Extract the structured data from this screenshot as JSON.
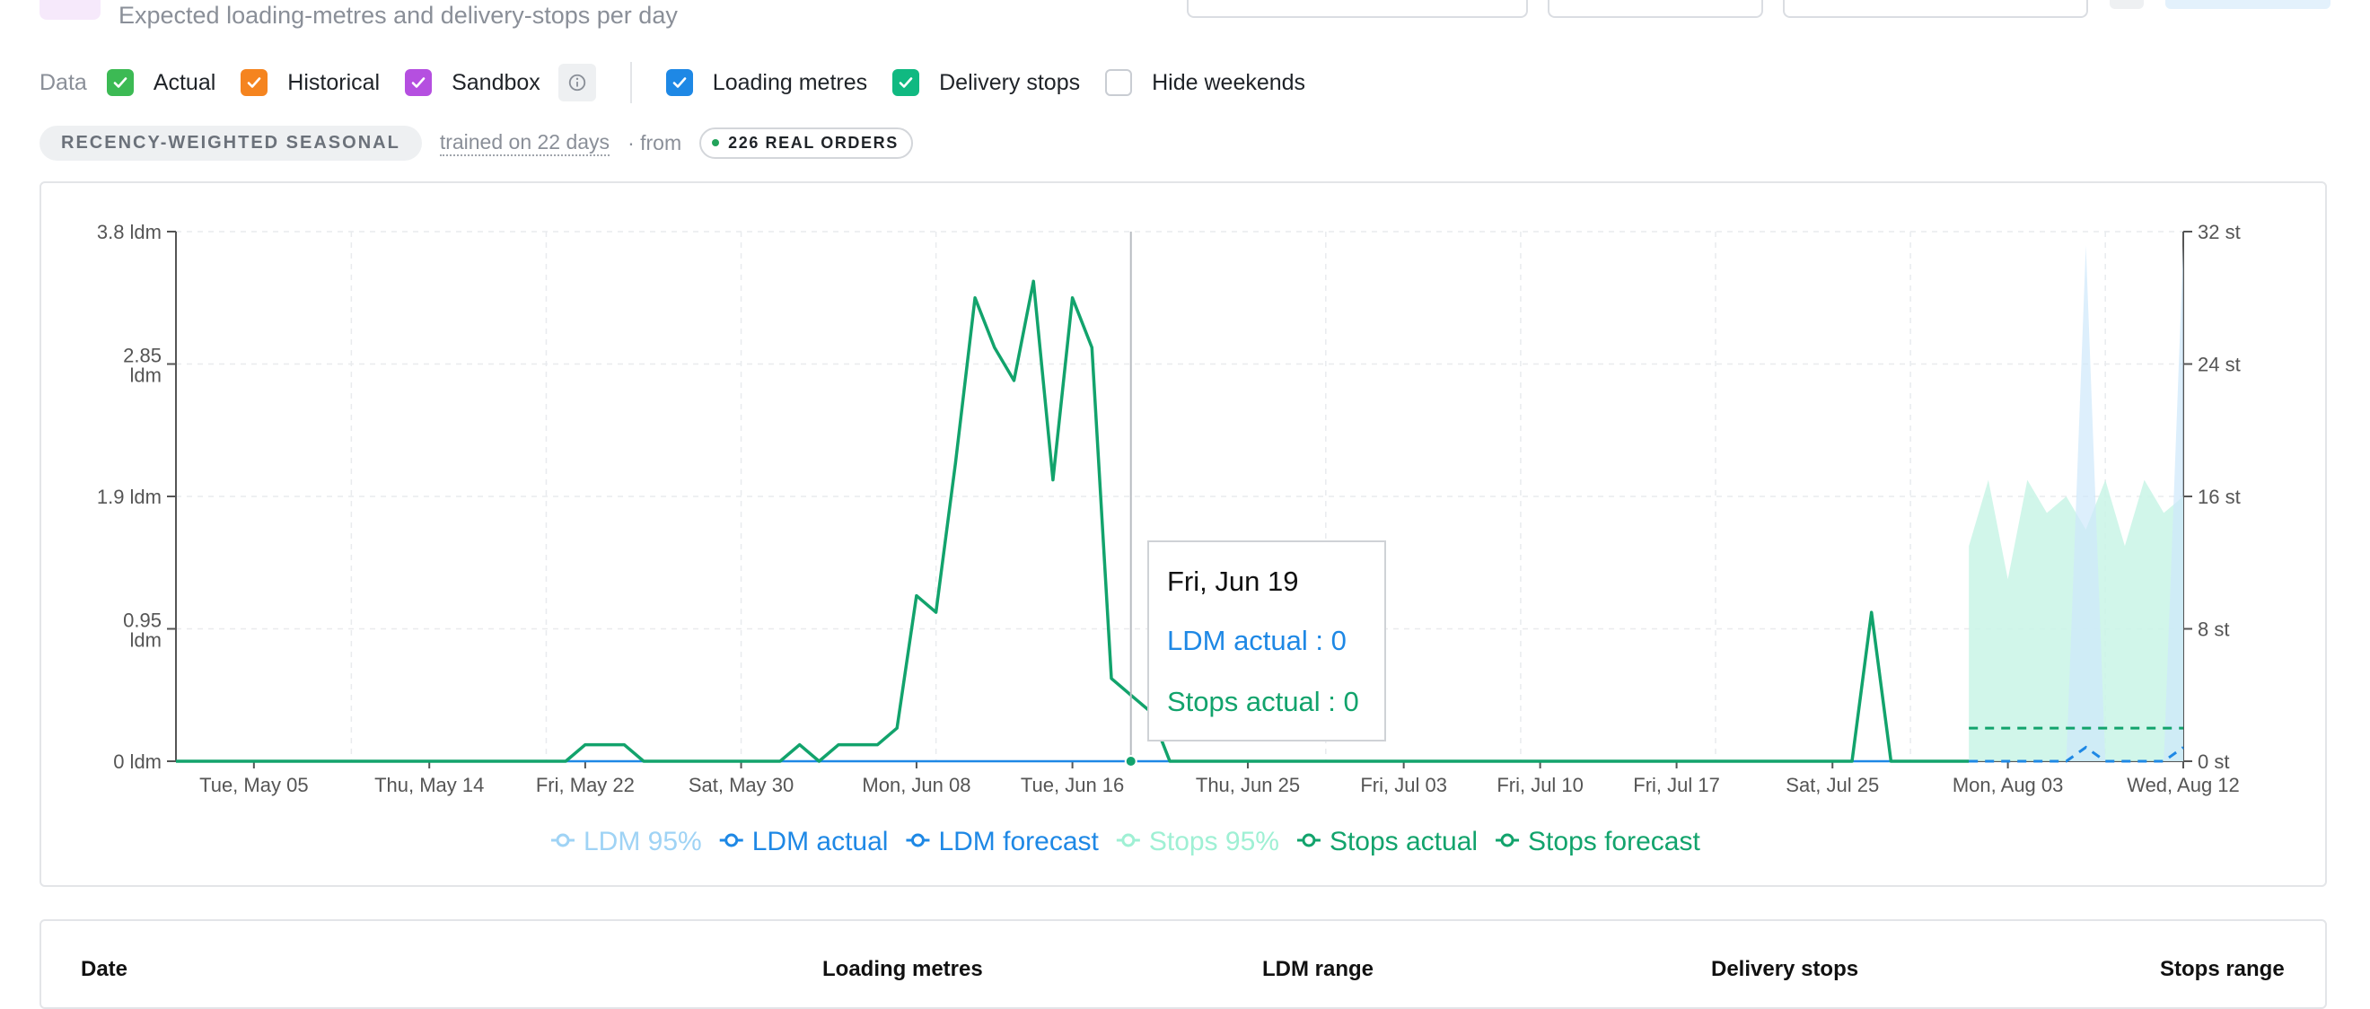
{
  "header": {
    "subtitle": "Expected loading-metres and delivery-stops per day"
  },
  "controls": {
    "data_label": "Data",
    "checkboxes": [
      {
        "label": "Actual",
        "checked": true,
        "color": "#3cba54"
      },
      {
        "label": "Historical",
        "checked": true,
        "color": "#f5841f"
      },
      {
        "label": "Sandbox",
        "checked": true,
        "color": "#b54fe0"
      },
      {
        "label": "Loading metres",
        "checked": true,
        "color": "#1e88e5"
      },
      {
        "label": "Delivery stops",
        "checked": true,
        "color": "#10b981"
      },
      {
        "label": "Hide weekends",
        "checked": false,
        "color": "#ffffff"
      }
    ],
    "info_icon": "info-icon"
  },
  "model": {
    "name": "RECENCY-WEIGHTED SEASONAL",
    "trained": "trained on 22 days",
    "from": "· from",
    "orders": "226 REAL ORDERS"
  },
  "tooltip": {
    "date": "Fri, Jun 19",
    "ldm": "LDM actual : 0",
    "stops": "Stops actual : 0"
  },
  "table": {
    "headers": [
      "Date",
      "Loading metres",
      "LDM range",
      "Delivery stops",
      "Stops range"
    ]
  },
  "chart_data": {
    "type": "line",
    "x_ticks": [
      "Tue, May 05",
      "Thu, May 14",
      "Fri, May 22",
      "Sat, May 30",
      "Mon, Jun 08",
      "Tue, Jun 16",
      "Thu, Jun 25",
      "Fri, Jul 03",
      "Fri, Jul 10",
      "Fri, Jul 17",
      "Sat, Jul 25",
      "Mon, Aug 03",
      "Wed, Aug 12"
    ],
    "x_range": [
      "2026-05-01",
      "2026-08-12"
    ],
    "y_left": {
      "ticks": [
        "3.8 ldm",
        "2.85 ldm",
        "1.9 ldm",
        "0.95 ldm",
        "0 ldm"
      ],
      "range": [
        0,
        3.8
      ]
    },
    "y_right": {
      "ticks": [
        "32 st",
        "24 st",
        "16 st",
        "8 st",
        "0 st"
      ],
      "range": [
        0,
        32
      ]
    },
    "grid": true,
    "legend": "bottom-center",
    "highlight_date": "2026-06-19",
    "colors": {
      "ldm": "#1e88e5",
      "ldm_band": "#cfe8fb",
      "stops": "#12a36c",
      "stops_band": "#c9f5e6"
    },
    "legend_items": [
      {
        "label": "LDM 95%",
        "color": "#9fd3f5"
      },
      {
        "label": "LDM actual",
        "color": "#1e88e5"
      },
      {
        "label": "LDM forecast",
        "color": "#1e88e5"
      },
      {
        "label": "Stops 95%",
        "color": "#9ff0d4"
      },
      {
        "label": "Stops actual",
        "color": "#12a36c"
      },
      {
        "label": "Stops forecast",
        "color": "#12a36c"
      }
    ],
    "series": [
      {
        "name": "Stops actual",
        "axis": "right",
        "points": [
          [
            "2026-05-01",
            0
          ],
          [
            "2026-05-21",
            0
          ],
          [
            "2026-05-22",
            1
          ],
          [
            "2026-05-24",
            1
          ],
          [
            "2026-05-25",
            0
          ],
          [
            "2026-06-01",
            0
          ],
          [
            "2026-06-02",
            1
          ],
          [
            "2026-06-03",
            0
          ],
          [
            "2026-06-04",
            1
          ],
          [
            "2026-06-06",
            1
          ],
          [
            "2026-06-07",
            2
          ],
          [
            "2026-06-08",
            10
          ],
          [
            "2026-06-09",
            9
          ],
          [
            "2026-06-10",
            18
          ],
          [
            "2026-06-11",
            28
          ],
          [
            "2026-06-12",
            25
          ],
          [
            "2026-06-13",
            23
          ],
          [
            "2026-06-14",
            29
          ],
          [
            "2026-06-15",
            17
          ],
          [
            "2026-06-16",
            28
          ],
          [
            "2026-06-17",
            25
          ],
          [
            "2026-06-18",
            5
          ],
          [
            "2026-06-19",
            4
          ],
          [
            "2026-06-20",
            3
          ],
          [
            "2026-06-21",
            0
          ],
          [
            "2026-07-26",
            0
          ],
          [
            "2026-07-27",
            9
          ],
          [
            "2026-07-28",
            0
          ],
          [
            "2026-08-01",
            0
          ]
        ]
      },
      {
        "name": "LDM actual",
        "axis": "left",
        "points": [
          [
            "2026-05-01",
            0
          ],
          [
            "2026-08-01",
            0
          ]
        ]
      },
      {
        "name": "Stops 95%",
        "axis": "right",
        "points": [
          [
            "2026-08-01",
            13
          ],
          [
            "2026-08-02",
            17
          ],
          [
            "2026-08-03",
            11
          ],
          [
            "2026-08-04",
            17
          ],
          [
            "2026-08-05",
            15
          ],
          [
            "2026-08-06",
            16
          ],
          [
            "2026-08-07",
            14
          ],
          [
            "2026-08-08",
            17
          ],
          [
            "2026-08-09",
            13
          ],
          [
            "2026-08-10",
            17
          ],
          [
            "2026-08-11",
            15
          ],
          [
            "2026-08-12",
            16
          ]
        ]
      },
      {
        "name": "LDM 95%",
        "axis": "left",
        "points": [
          [
            "2026-08-01",
            0
          ],
          [
            "2026-08-06",
            0
          ],
          [
            "2026-08-07",
            3.7
          ],
          [
            "2026-08-08",
            0
          ],
          [
            "2026-08-11",
            0
          ],
          [
            "2026-08-12",
            3.7
          ]
        ]
      },
      {
        "name": "Stops forecast",
        "axis": "right",
        "points": [
          [
            "2026-08-01",
            2
          ],
          [
            "2026-08-12",
            2
          ]
        ]
      },
      {
        "name": "LDM forecast",
        "axis": "left",
        "points": [
          [
            "2026-08-01",
            0
          ],
          [
            "2026-08-06",
            0
          ],
          [
            "2026-08-07",
            0.1
          ],
          [
            "2026-08-08",
            0
          ],
          [
            "2026-08-11",
            0
          ],
          [
            "2026-08-12",
            0.1
          ]
        ]
      }
    ]
  }
}
